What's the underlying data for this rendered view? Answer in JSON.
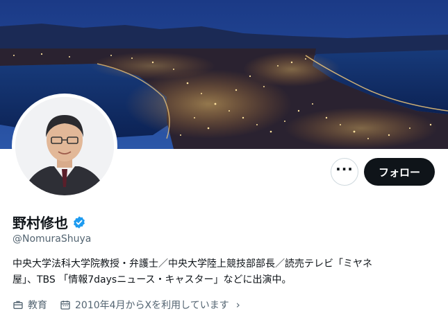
{
  "profile": {
    "display_name": "野村修也",
    "handle": "@NomuraShuya",
    "bio_line1": "中央大学法科大学院教授・弁護士／中央大学陸上競技部部長／読売テレビ「ミヤネ",
    "bio_line2": "屋」、TBS 「情報7daysニュース・キャスター」などに出演中。",
    "verified": true
  },
  "actions": {
    "more_label": "···",
    "follow_label": "フォロー"
  },
  "meta": {
    "category": "教育",
    "joined": "2010年4月からXを利用しています"
  },
  "icons": {
    "more": "more-dots-icon",
    "verified": "verified-badge-icon",
    "category": "briefcase-icon",
    "joined": "calendar-icon",
    "chevron": "chevron-right-icon"
  },
  "colors": {
    "verified": "#1d9bf0",
    "follow_bg": "#0f1419",
    "secondary_text": "#536471"
  }
}
